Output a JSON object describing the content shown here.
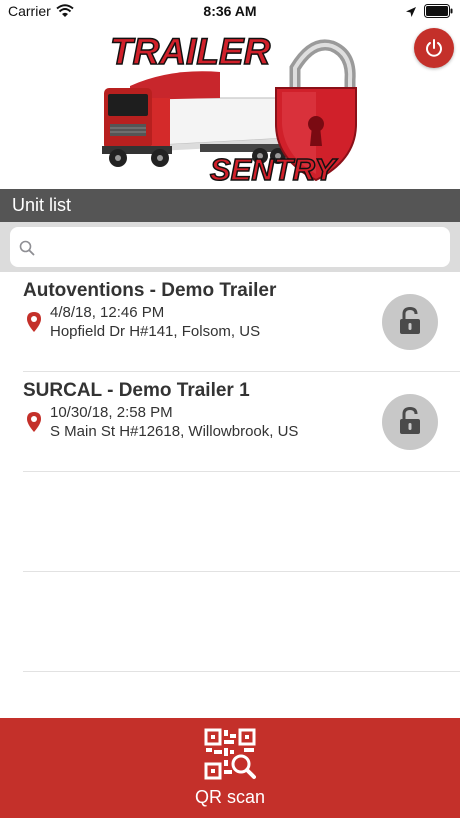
{
  "status_bar": {
    "carrier": "Carrier",
    "time": "8:36 AM"
  },
  "logo": {
    "word_top": "TRAILER",
    "word_bottom": "SENTRY"
  },
  "section": {
    "title": "Unit list"
  },
  "search": {
    "value": "",
    "placeholder": ""
  },
  "units": [
    {
      "name": "Autoventions - Demo Trailer",
      "time": "4/8/18, 12:46 PM",
      "address": "Hopfield Dr H#141, Folsom, US",
      "lock_state": "unlocked"
    },
    {
      "name": "SURCAL - Demo Trailer 1",
      "time": "10/30/18, 2:58 PM",
      "address": "S Main St H#12618, Willowbrook, US",
      "lock_state": "unlocked"
    }
  ],
  "qr": {
    "label": "QR scan"
  },
  "colors": {
    "accent": "#c4302a",
    "header": "#555555",
    "search_bg": "#dcdcdc",
    "lock_button": "#c8c8c8"
  }
}
